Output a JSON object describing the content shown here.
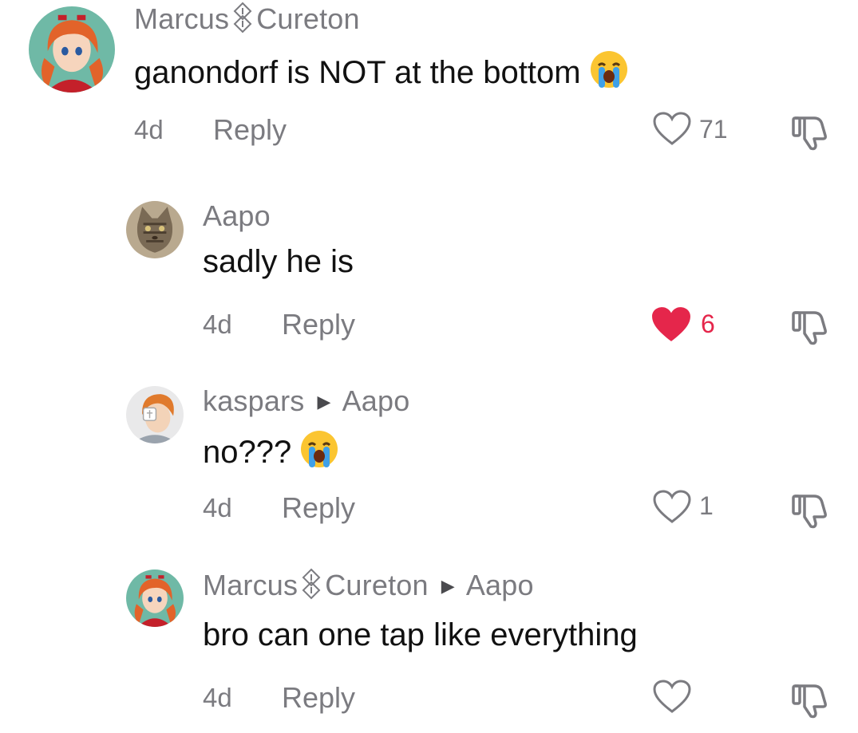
{
  "comments": [
    {
      "username": "Marcus",
      "username_suffix": "Cureton",
      "text": "ganondorf is NOT at the bottom",
      "time": "4d",
      "reply_label": "Reply",
      "likes": "71",
      "liked": false,
      "avatar": "anime-girl-red-hair"
    },
    {
      "username": "Aapo",
      "text": "sadly he is",
      "time": "4d",
      "reply_label": "Reply",
      "likes": "6",
      "liked": true,
      "avatar": "cat"
    },
    {
      "username": "kaspars",
      "reply_to": "Aapo",
      "text": "no???",
      "time": "4d",
      "reply_label": "Reply",
      "likes": "1",
      "liked": false,
      "avatar": "anime-boy-orange-hair"
    },
    {
      "username": "Marcus",
      "username_suffix": "Cureton",
      "reply_to": "Aapo",
      "text": "bro can one tap like everything",
      "time": "4d",
      "reply_label": "Reply",
      "likes": "",
      "liked": false,
      "avatar": "anime-girl-red-hair"
    }
  ],
  "colors": {
    "liked": "#e5264b",
    "muted": "#7b7b80",
    "text": "#111111"
  }
}
